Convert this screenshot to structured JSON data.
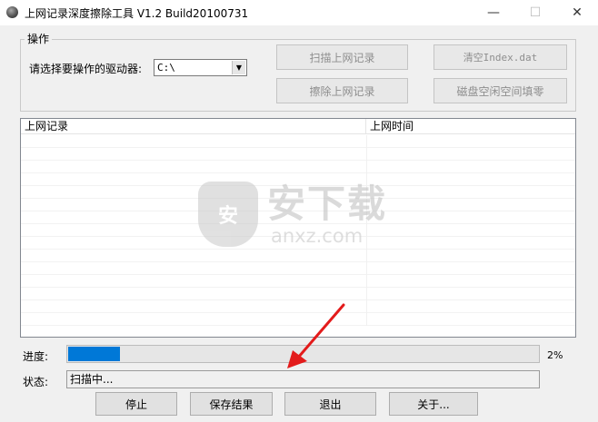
{
  "window": {
    "title": "上网记录深度擦除工具 V1.2   Build20100731",
    "minimize_glyph": "—",
    "maximize_glyph": "☐",
    "close_glyph": "✕"
  },
  "operations": {
    "legend": "操作",
    "drive_label": "请选择要操作的驱动器:",
    "drive_value": "C:\\",
    "buttons": {
      "scan": "扫描上网记录",
      "clear_index": "清空Index.dat",
      "erase": "擦除上网记录",
      "wipe_free": "磁盘空闲空间填零"
    }
  },
  "list": {
    "columns": [
      "上网记录",
      "上网时间"
    ]
  },
  "watermark": {
    "text": "安下载",
    "sub": "anxz.com",
    "shield_glyph": "安"
  },
  "progress": {
    "label": "进度:",
    "value": 2,
    "percent_text": "2%"
  },
  "status": {
    "label": "状态:",
    "text": "扫描中..."
  },
  "bottom_buttons": {
    "stop": "停止",
    "save": "保存结果",
    "exit": "退出",
    "about": "关于..."
  },
  "colors": {
    "progress_fill": "#0078d7",
    "arrow": "#e31b1b"
  }
}
